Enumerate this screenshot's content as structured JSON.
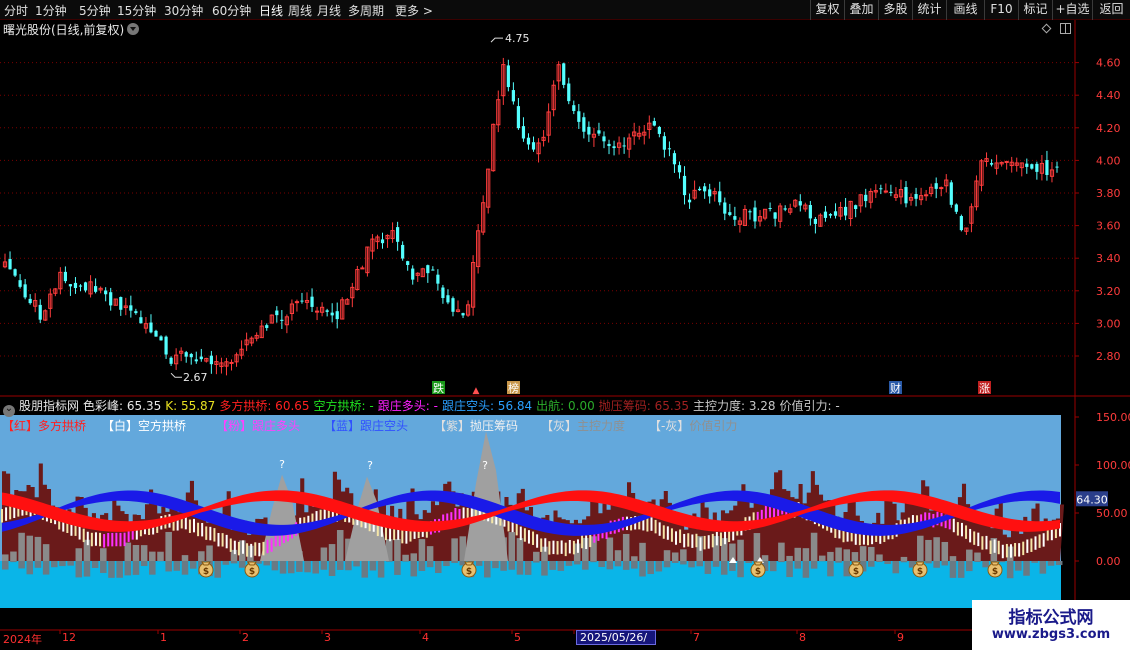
{
  "toolbar": {
    "timeframes": [
      "分时",
      "1分钟",
      "5分钟",
      "15分钟",
      "30分钟",
      "60分钟",
      "日线",
      "周线",
      "月线",
      "多周期",
      "更多"
    ],
    "active_timeframe": "日线",
    "right_buttons": [
      "复权",
      "叠加",
      "多股",
      "统计",
      "画线",
      "F10",
      "标记",
      "+自选",
      "返回"
    ]
  },
  "stock": {
    "title": "曙光股份(日线,前复权)"
  },
  "price_axis": {
    "labels": [
      "4.60",
      "4.40",
      "4.20",
      "4.00",
      "3.80",
      "3.60",
      "3.40",
      "3.20",
      "3.00",
      "2.80"
    ]
  },
  "price_annotations": {
    "high": "4.75",
    "low": "2.67"
  },
  "event_markers": [
    {
      "text": "跌",
      "color": "#1a9a1a"
    },
    {
      "text": "榜",
      "color": "#c8964a"
    },
    {
      "text": "财",
      "color": "#2a5aa8"
    },
    {
      "text": "涨",
      "color": "#c02020"
    }
  ],
  "indicator_bar": {
    "name": "股朋指标网",
    "items": [
      {
        "text": "色彩峰: 65.35",
        "color": "#e8e8e8"
      },
      {
        "text": "K: 55.87",
        "color": "#e8e020"
      },
      {
        "text": "多方拱桥: 60.65",
        "color": "#ff2020"
      },
      {
        "text": "空方拱桥: -",
        "color": "#20e020"
      },
      {
        "text": "跟庄多头: -",
        "color": "#ff20ff"
      },
      {
        "text": "跟庄空头: 56.84",
        "color": "#2aa0ff"
      },
      {
        "text": "出航: 0.00",
        "color": "#2aaa2a"
      },
      {
        "text": "抛压筹码: 65.35",
        "color": "#a02020"
      },
      {
        "text": "主控力度: 3.28",
        "color": "#c8c8c8"
      },
      {
        "text": "价值引力: -",
        "color": "#c8c8c8"
      }
    ]
  },
  "legend": [
    {
      "tag": "【红】",
      "label": "多方拱桥",
      "color": "#ff2020"
    },
    {
      "tag": "【白】",
      "label": "空方拱桥",
      "color": "#ffffff"
    },
    {
      "tag": "【粉】",
      "label": "跟庄多头",
      "color": "#ff40ff"
    },
    {
      "tag": "【蓝】",
      "label": "跟庄空头",
      "color": "#3050ff"
    },
    {
      "tag": "【紫】",
      "label": "抛压筹码",
      "color": "#f0f0f0"
    },
    {
      "tag": "【灰】",
      "label": "主控力度",
      "color": "#909090"
    },
    {
      "tag": "【-灰】",
      "label": "价值引力",
      "color": "#909090"
    }
  ],
  "indicator_axis": {
    "labels": [
      "150.00",
      "100.00",
      "50.00",
      "0.00"
    ],
    "current_value": "64.30"
  },
  "date_axis": {
    "labels": [
      "2024年",
      "12",
      "1",
      "2",
      "3",
      "4",
      "5",
      "7",
      "8",
      "9"
    ],
    "current_date": "2025/05/26/—"
  },
  "watermark": {
    "title": "指标公式网",
    "url": "www.zbgs3.com"
  },
  "colors": {
    "up": "#ff3c3c",
    "down": "#54ffff",
    "grid": "#7a0000",
    "sky": "#63a8dc",
    "cyan_fill": "#0ab5e8",
    "bear_red": "#6a1a1a",
    "gray_hist": "#8a8a8a",
    "bridge_red": "#ff1010",
    "bridge_blue": "#1a1ae8",
    "zigzag_pink": "#ff30ff"
  },
  "icons": {
    "money_bag": "money-bag-icon",
    "question": "?",
    "triangle": "up-triangle-icon"
  },
  "chart_data": [
    {
      "type": "candlestick",
      "title": "曙光股份(日线,前复权)",
      "ylim": [
        2.6,
        4.8
      ],
      "y_ticks": [
        2.8,
        3.0,
        3.2,
        3.4,
        3.6,
        3.8,
        4.0,
        4.2,
        4.4,
        4.6
      ],
      "annotations": [
        {
          "label": "4.75",
          "value": 4.75
        },
        {
          "label": "2.67",
          "value": 2.67
        }
      ],
      "x_labels": [
        "2024年",
        "12",
        "1",
        "2",
        "3",
        "4",
        "5",
        "7",
        "8",
        "9"
      ],
      "series_note": "daily OHLC, approximate trajectory",
      "close_path": [
        3.34,
        3.19,
        3.05,
        3.28,
        3.25,
        3.22,
        3.12,
        3.04,
        2.93,
        2.79,
        2.82,
        2.76,
        2.74,
        2.85,
        3.0,
        3.05,
        3.12,
        3.07,
        3.05,
        3.27,
        3.52,
        3.54,
        3.27,
        3.35,
        3.12,
        3.06,
        3.85,
        4.58,
        4.13,
        4.08,
        4.57,
        4.22,
        4.17,
        4.06,
        4.13,
        4.21,
        4.05,
        3.77,
        3.85,
        3.68,
        3.66,
        3.66,
        3.69,
        3.74,
        3.64,
        3.66,
        3.73,
        3.79,
        3.83,
        3.75,
        3.79,
        3.84,
        3.56,
        4.03,
        3.95,
        3.97,
        3.95,
        3.94
      ]
    },
    {
      "type": "indicator",
      "title": "股朋指标网",
      "ylim": [
        -100,
        150
      ],
      "y_ticks": [
        0,
        50,
        100,
        150
      ],
      "current_value": 64.3,
      "series": [
        {
          "name": "多方拱桥",
          "color": "#ff2020"
        },
        {
          "name": "空方拱桥",
          "color": "#ffffff"
        },
        {
          "name": "跟庄多头",
          "color": "#ff40ff"
        },
        {
          "name": "跟庄空头",
          "color": "#3050ff"
        },
        {
          "name": "抛压筹码",
          "color": "#f0f0f0"
        },
        {
          "name": "主控力度",
          "color": "#909090"
        },
        {
          "name": "价值引力",
          "color": "#909090"
        }
      ]
    }
  ]
}
